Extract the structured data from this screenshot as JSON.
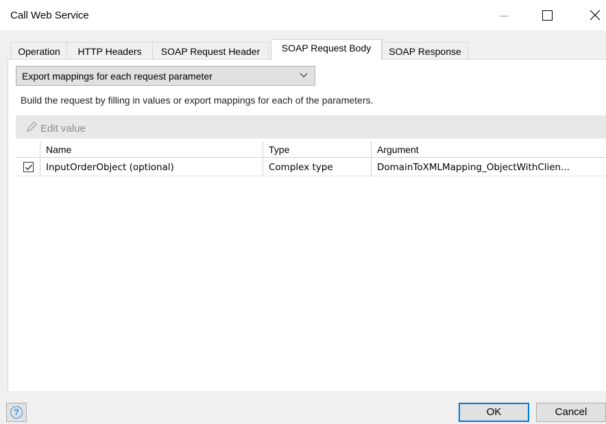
{
  "window": {
    "title": "Call Web Service"
  },
  "tabs": [
    {
      "label": "Operation",
      "active": false
    },
    {
      "label": "HTTP Headers",
      "active": false
    },
    {
      "label": "SOAP Request Header",
      "active": false
    },
    {
      "label": "SOAP Request Body",
      "active": true
    },
    {
      "label": "SOAP Response",
      "active": false
    }
  ],
  "body": {
    "dropdown_value": "Export mappings for each request parameter",
    "description": "Build the request by filling in values or export mappings for each of the parameters.",
    "edit_value_label": "Edit value"
  },
  "grid": {
    "columns": [
      "Name",
      "Type",
      "Argument"
    ],
    "rows": [
      {
        "checked": true,
        "name": "InputOrderObject (optional)",
        "type": "Complex type",
        "argument": "DomainToXMLMapping_ObjectWithClien..."
      }
    ]
  },
  "footer": {
    "help_icon": "help-circle-icon",
    "ok_label": "OK",
    "cancel_label": "Cancel"
  },
  "colors": {
    "focus_border": "#0078d7",
    "help_icon": "#3a8ee6"
  }
}
